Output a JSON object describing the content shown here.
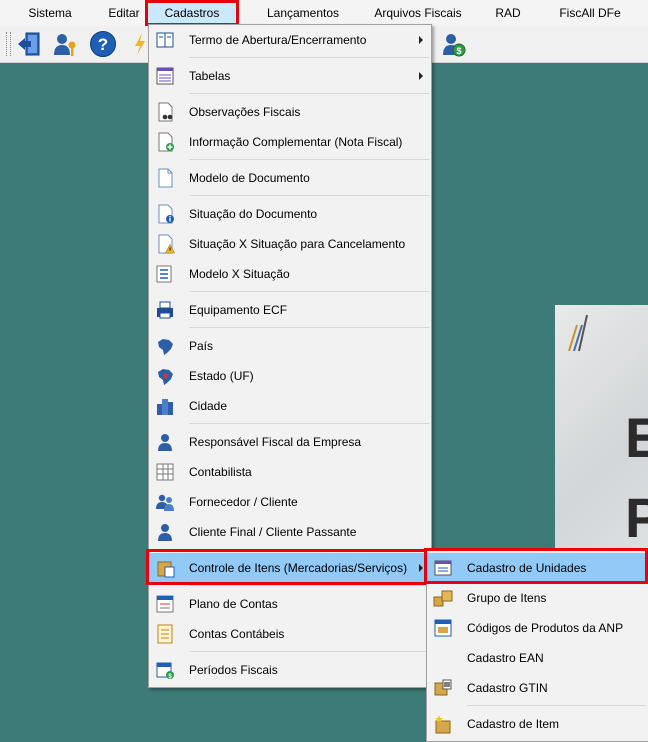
{
  "menubar": {
    "items": [
      "Sistema",
      "Editar",
      "Cadastros",
      "Lançamentos",
      "Arquivos Fiscais",
      "RAD",
      "FiscAll DFe"
    ],
    "active": "Cadastros"
  },
  "toolbar": {
    "buttons": [
      "exit-icon",
      "user-key-icon",
      "help-icon",
      "lightning-icon",
      "user-money-icon"
    ]
  },
  "cadastros_menu": {
    "items": [
      {
        "label": "Termo de Abertura/Encerramento",
        "icon": "book-icon",
        "submenu": true
      },
      {
        "label": "Tabelas",
        "icon": "table-list-icon",
        "submenu": true
      },
      {
        "label": "Observações Fiscais",
        "icon": "document-binoculars-icon"
      },
      {
        "label": "Informação Complementar (Nota Fiscal)",
        "icon": "document-plus-icon"
      },
      {
        "label": "Modelo de Documento",
        "icon": "blank-document-icon"
      },
      {
        "label": "Situação do Documento",
        "icon": "document-info-icon"
      },
      {
        "label": "Situação X Situação para Cancelamento",
        "icon": "document-warning-icon"
      },
      {
        "label": "Modelo X Situação",
        "icon": "document-list-icon"
      },
      {
        "label": "Equipamento ECF",
        "icon": "printer-icon"
      },
      {
        "label": "País",
        "icon": "brazil-map-icon"
      },
      {
        "label": "Estado (UF)",
        "icon": "brazil-state-map-icon"
      },
      {
        "label": "Cidade",
        "icon": "city-buildings-icon"
      },
      {
        "label": "Responsável Fiscal da Empresa",
        "icon": "person-icon"
      },
      {
        "label": "Contabilista",
        "icon": "spreadsheet-icon"
      },
      {
        "label": "Fornecedor / Cliente",
        "icon": "two-people-icon"
      },
      {
        "label": "Cliente Final / Cliente Passante",
        "icon": "person-icon"
      },
      {
        "label": "Controle de Itens (Mercadorias/Serviços)",
        "icon": "box-document-icon",
        "submenu": true,
        "highlighted": true
      },
      {
        "label": "Plano de Contas",
        "icon": "ledger-icon"
      },
      {
        "label": "Contas Contábeis",
        "icon": "receipt-icon"
      },
      {
        "label": "Períodos Fiscais",
        "icon": "calendar-money-icon"
      }
    ]
  },
  "itens_submenu": {
    "items": [
      {
        "label": "Cadastro de Unidades",
        "icon": "unit-ruler-icon",
        "highlighted": true
      },
      {
        "label": "Grupo de Itens",
        "icon": "boxes-icon"
      },
      {
        "label": "Códigos de Produtos da ANP",
        "icon": "fuel-code-icon"
      },
      {
        "label": "Cadastro EAN",
        "icon": ""
      },
      {
        "label": "Cadastro GTIN",
        "icon": "box-barcode-icon"
      },
      {
        "label": "Cadastro de Item",
        "icon": "box-star-icon"
      }
    ]
  },
  "background": {
    "letters": [
      "E",
      "P"
    ]
  },
  "colors": {
    "desktop": "#3d7b78",
    "highlight": "#91c9f7",
    "annotation": "#e8000f"
  }
}
